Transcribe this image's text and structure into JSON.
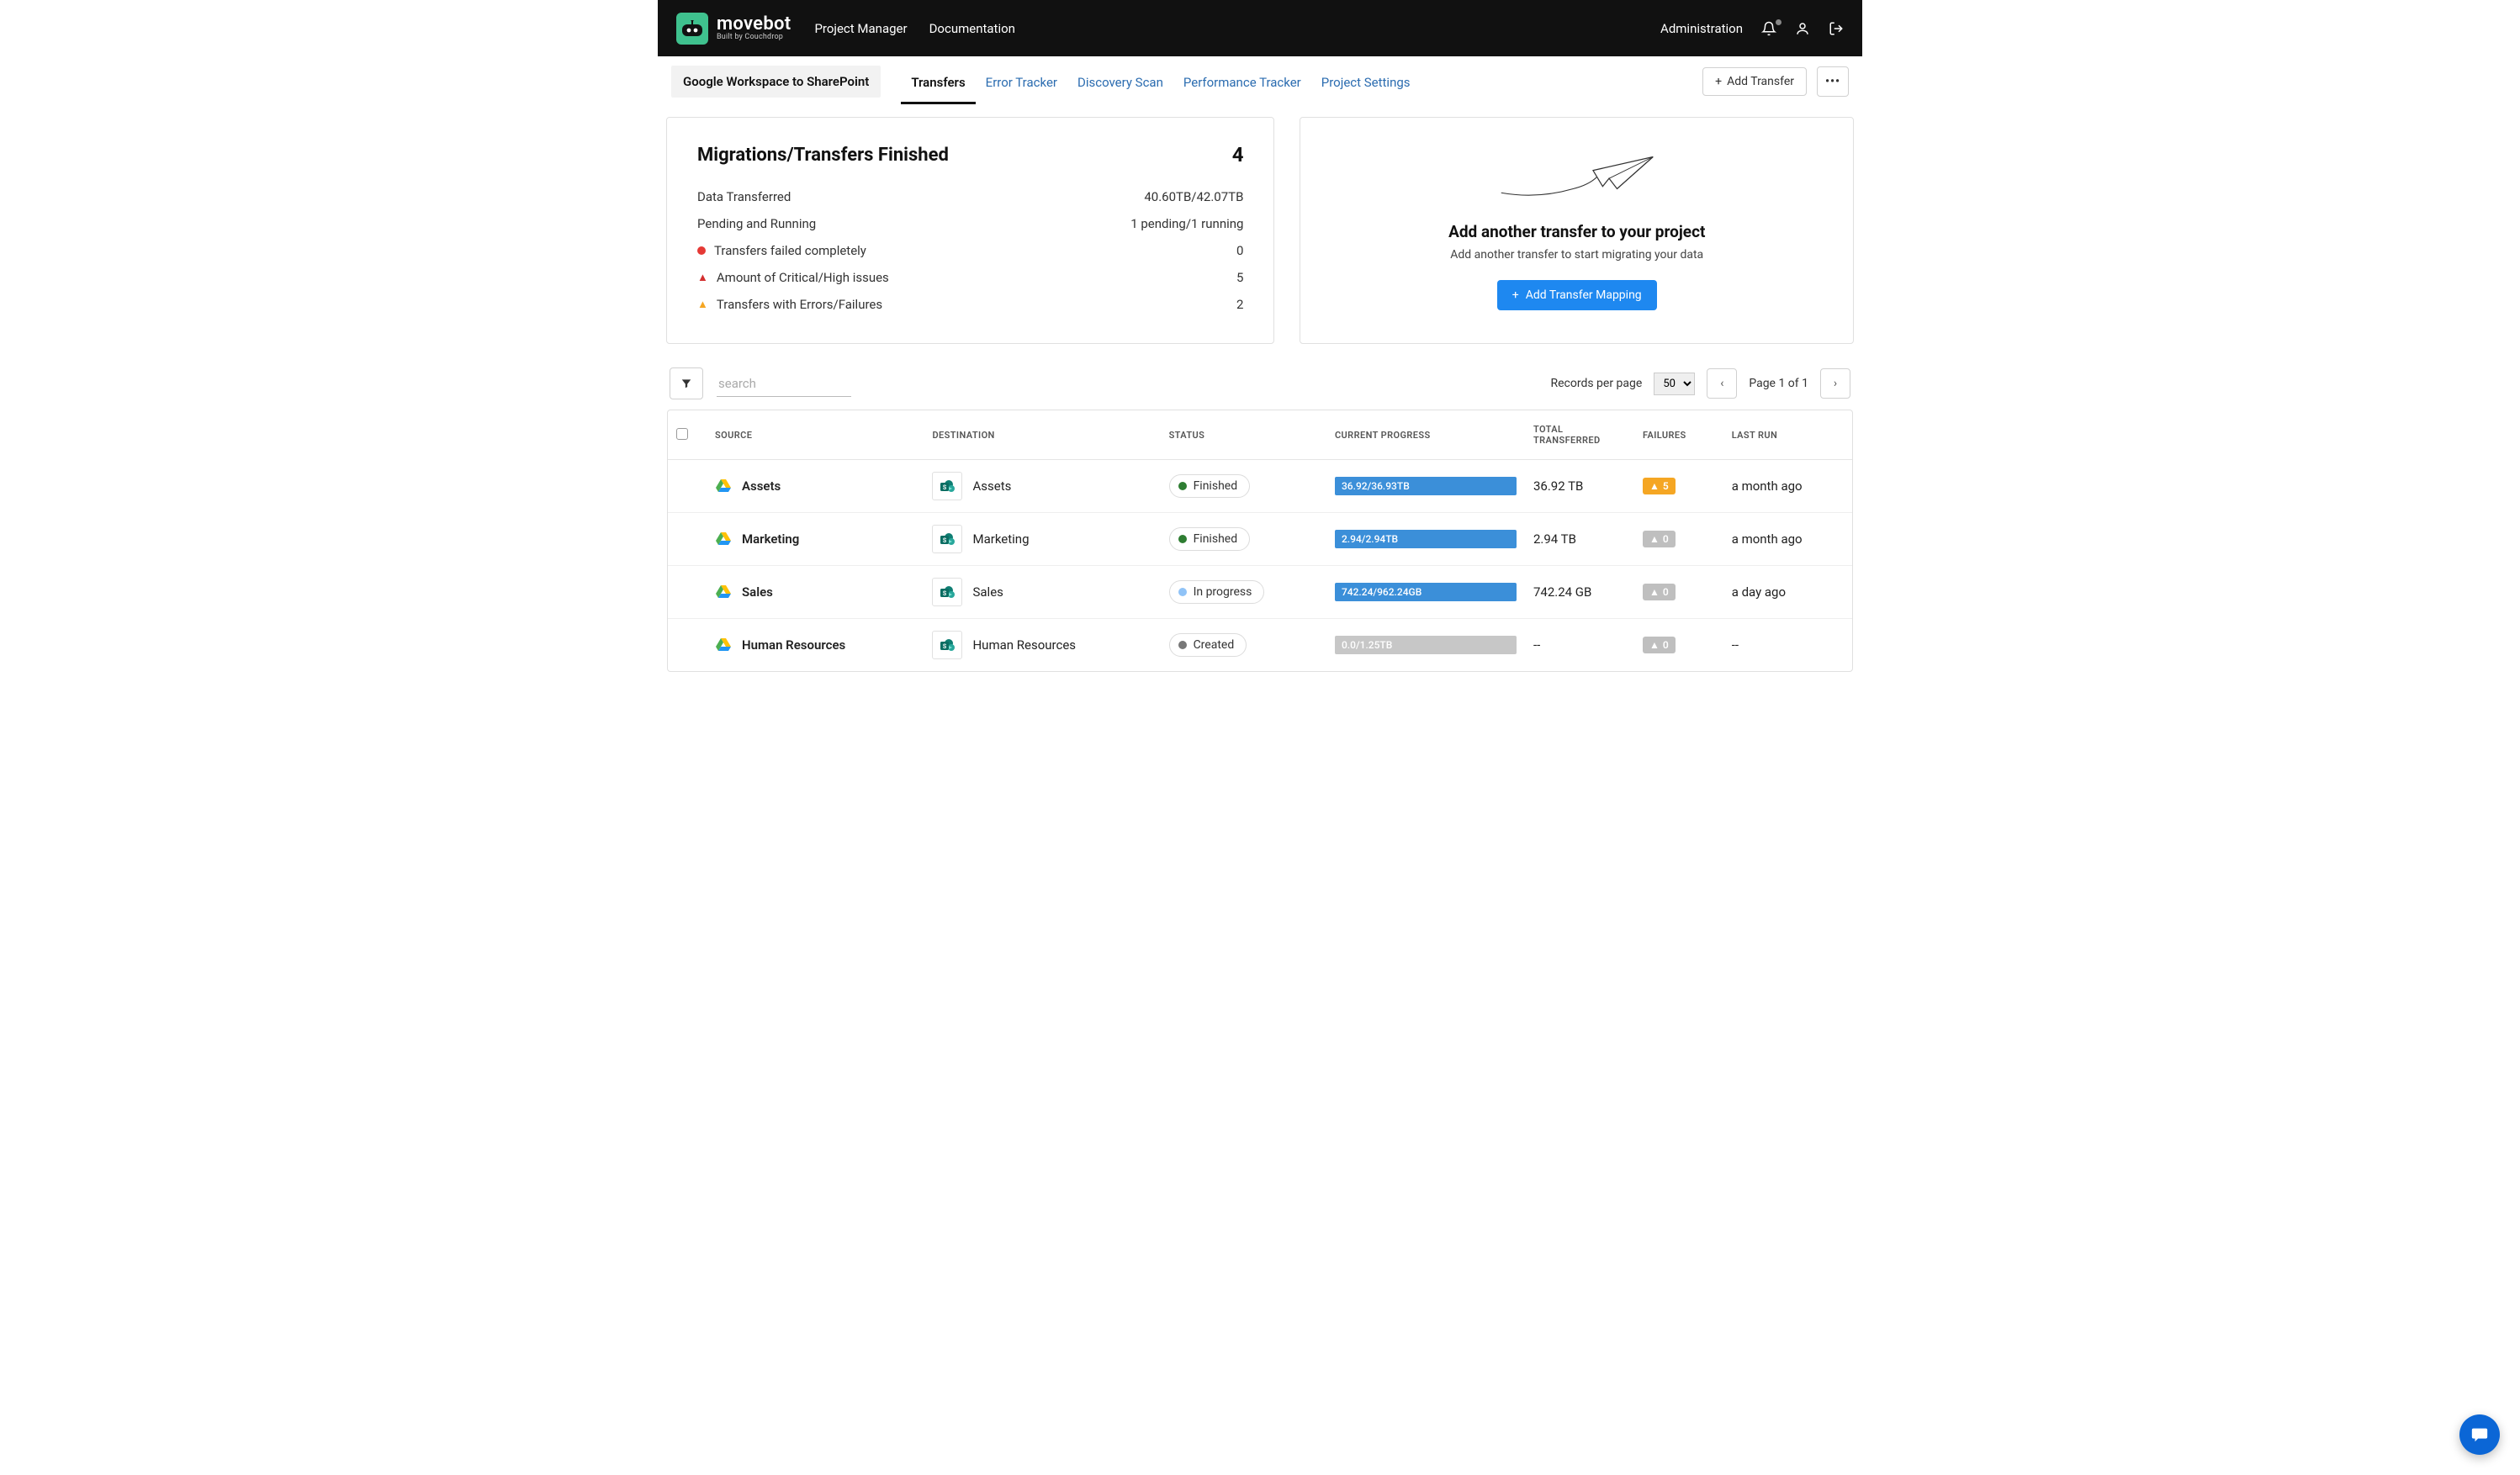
{
  "header": {
    "brand_main": "movebot",
    "brand_sub": "Built by Couchdrop",
    "nav": {
      "project_manager": "Project Manager",
      "documentation": "Documentation"
    },
    "admin_link": "Administration"
  },
  "ribbon": {
    "project_name": "Google Workspace to SharePoint",
    "tabs": {
      "transfers": "Transfers",
      "error_tracker": "Error Tracker",
      "discovery_scan": "Discovery Scan",
      "performance_tracker": "Performance Tracker",
      "project_settings": "Project Settings"
    },
    "add_transfer_label": "Add Transfer"
  },
  "summary": {
    "title": "Migrations/Transfers Finished",
    "finished_count": "4",
    "rows": {
      "data_transferred": {
        "label": "Data Transferred",
        "value": "40.60TB/42.07TB"
      },
      "pending_running": {
        "label": "Pending and Running",
        "value": "1 pending/1 running"
      },
      "failed": {
        "label": "Transfers failed completely",
        "value": "0"
      },
      "critical": {
        "label": "Amount of Critical/High issues",
        "value": "5"
      },
      "with_errors": {
        "label": "Transfers with Errors/Failures",
        "value": "2"
      }
    }
  },
  "promo": {
    "title": "Add another transfer to your project",
    "subtitle": "Add another transfer to start migrating your data",
    "cta": "Add Transfer Mapping"
  },
  "filter": {
    "search_placeholder": "search",
    "records_label": "Records per page",
    "records_value": "50",
    "page_text": "Page 1 of 1"
  },
  "table": {
    "cols": {
      "source": "SOURCE",
      "destination": "DESTINATION",
      "status": "STATUS",
      "progress": "CURRENT PROGRESS",
      "total": "TOTAL TRANSFERRED",
      "failures": "FAILURES",
      "last_run": "LAST RUN"
    },
    "rows": [
      {
        "source": "Assets",
        "destination": "Assets",
        "status": "Finished",
        "status_color": "green",
        "progress": "36.92/36.93TB",
        "progress_color": "blue",
        "total": "36.92 TB",
        "fail_count": "5",
        "fail_color": "orange",
        "last_run": "a month ago"
      },
      {
        "source": "Marketing",
        "destination": "Marketing",
        "status": "Finished",
        "status_color": "green",
        "progress": "2.94/2.94TB",
        "progress_color": "blue",
        "total": "2.94 TB",
        "fail_count": "0",
        "fail_color": "grey",
        "last_run": "a month ago"
      },
      {
        "source": "Sales",
        "destination": "Sales",
        "status": "In progress",
        "status_color": "blue",
        "progress": "742.24/962.24GB",
        "progress_color": "blue",
        "total": "742.24 GB",
        "fail_count": "0",
        "fail_color": "grey",
        "last_run": "a day ago"
      },
      {
        "source": "Human Resources",
        "destination": "Human Resources",
        "status": "Created",
        "status_color": "grey",
        "progress": "0.0/1.25TB",
        "progress_color": "grey",
        "total": "--",
        "fail_count": "0",
        "fail_color": "grey",
        "last_run": "--"
      }
    ]
  }
}
